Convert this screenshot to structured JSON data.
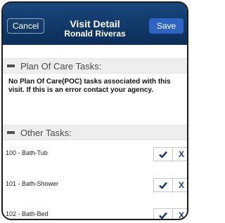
{
  "header": {
    "cancel_label": "Cancel",
    "title": "Visit Detail",
    "subtitle": "Ronald Riveras",
    "save_label": "Save"
  },
  "poc_section": {
    "title": "Plan Of Care Tasks:",
    "message": "No Plan Of Care(POC) tasks associated with this visit. If this is an error contact your agency."
  },
  "other_section": {
    "title": "Other Tasks:",
    "tasks": [
      {
        "label": "100 - Bath-Tub",
        "x_label": "X"
      },
      {
        "label": "101 - Bath-Shower",
        "x_label": "X"
      },
      {
        "label": "102 - Bath-Bed",
        "x_label": "X"
      }
    ]
  },
  "icons": {
    "section_marker": "minus-icon",
    "complete": "checkmark-icon"
  },
  "colors": {
    "navbar": "#12396a",
    "save_button": "#2f63c4",
    "accent": "#1e3f73",
    "section_bg": "#eeeeee"
  }
}
